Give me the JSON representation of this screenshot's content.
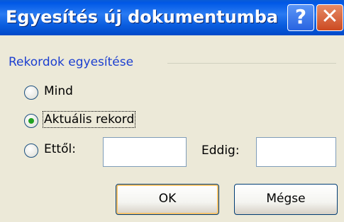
{
  "window": {
    "title": "Egyesítés új dokumentumba",
    "help_label": "?",
    "close_label": "✕"
  },
  "group": {
    "label": "Rekordok egyesítése",
    "options": [
      {
        "label": "Mind",
        "selected": false
      },
      {
        "label": "Aktuális rekord",
        "selected": true
      },
      {
        "label": "Ettől:",
        "selected": false
      }
    ],
    "to_label": "Eddig:",
    "from_value": "",
    "to_value": ""
  },
  "buttons": {
    "ok_label": "OK",
    "cancel_label": "Mégse"
  }
}
